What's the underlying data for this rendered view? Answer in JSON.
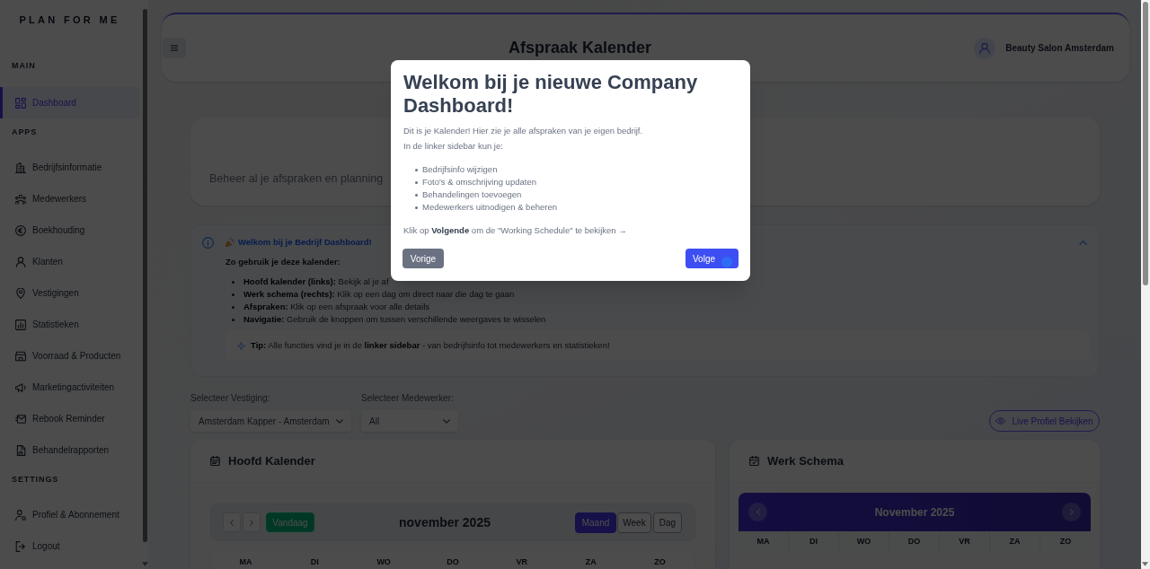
{
  "sidebar": {
    "logo": "PLAN FOR ME",
    "sections": [
      {
        "title": "MAIN",
        "items": [
          {
            "label": "Dashboard",
            "selected": true
          }
        ]
      },
      {
        "title": "APPS",
        "items": [
          {
            "label": "Bedrijfsinformatie",
            "selected": false
          },
          {
            "label": "Medewerkers",
            "selected": false
          },
          {
            "label": "Boekhouding",
            "selected": false
          },
          {
            "label": "Klanten",
            "selected": false
          },
          {
            "label": "Vestigingen",
            "selected": false
          },
          {
            "label": "Statistieken",
            "selected": false
          },
          {
            "label": "Voorraad & Producten",
            "selected": false
          },
          {
            "label": "Marketingactiviteiten",
            "selected": false
          },
          {
            "label": "Rebook Reminder",
            "selected": false
          },
          {
            "label": "Behandelrapporten",
            "selected": false
          }
        ]
      },
      {
        "title": "SETTINGS",
        "items": [
          {
            "label": "Profiel & Abonnement",
            "selected": false
          },
          {
            "label": "Logout",
            "selected": false
          }
        ]
      }
    ]
  },
  "header": {
    "title": "Afspraak Kalender",
    "account": "Beauty Salon Amsterdam"
  },
  "intro_card": {
    "text": "Beheer al je afspraken en planning"
  },
  "info_panel": {
    "title": "Welkom bij je Bedrijf Dashboard!",
    "expanded": true,
    "subtitle": "Zo gebruik je deze kalender:",
    "items": [
      "**Hoofd kalender (links):** Bekijk al je af",
      "**Werk schema (rechts):** Klik op een dag om direct naar die dag te gaan",
      "**Afspraken:** Klik op een afspraak voor alle details",
      "**Navigatie:** Gebruik de knoppen om tussen verschillende weergaves te wisselen"
    ],
    "tip": "**Tip:** Alle functies vind je in de **linker sidebar** - van bedrijfsinfo tot medewerkers en statistieken!"
  },
  "filters": [
    {
      "label": "Selecteer Vestiging:",
      "value": "Amsterdam Kapper - Amsterdam"
    },
    {
      "label": "Selecteer Medewerker:",
      "value": "All"
    }
  ],
  "live_profile_button": "Live Profiel Bekijken",
  "main_calendar": {
    "title": "Hoofd Kalender",
    "today_button": "Vandaag",
    "month": "november 2025",
    "views": [
      {
        "label": "Maand",
        "selected": true
      },
      {
        "label": "Week",
        "selected": false
      },
      {
        "label": "Dag",
        "selected": false
      }
    ],
    "weekdays": [
      "MA",
      "DI",
      "WO",
      "DO",
      "VR",
      "ZA",
      "ZO"
    ]
  },
  "work_schedule": {
    "title": "Werk Schema",
    "month": "November 2025",
    "weekdays": [
      "MA",
      "DI",
      "WO",
      "DO",
      "VR",
      "ZA",
      "ZO"
    ]
  },
  "modal": {
    "title": "Welkom bij je nieuwe Company Dashboard!",
    "paragraphs": [
      "Dit is je Kalender! Hier zie je alle afspraken van je eigen bedrijf.",
      "In de linker sidebar kun je:"
    ],
    "items": [
      "Bedrijfsinfo wijzigen",
      "Foto's & omschrijving updaten",
      "Behandelingen toevoegen",
      "Medewerkers uitnodigen & beheren"
    ],
    "footer": "Klik op **Volgende** om de \"Working Schedule\" te bekijken →",
    "buttons": [
      {
        "label": "Vorige",
        "kind": "secondary"
      },
      {
        "label": "Volge",
        "kind": "primary"
      }
    ]
  }
}
